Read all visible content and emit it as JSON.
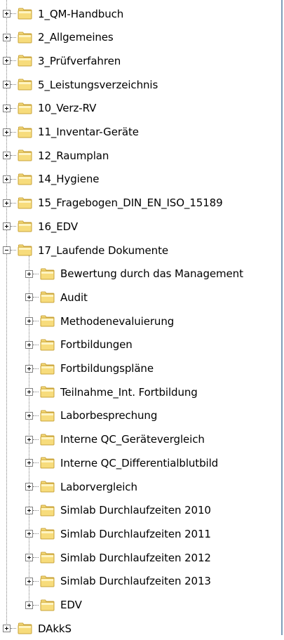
{
  "tree": {
    "top_items": [
      {
        "label": "1_QM-Handbuch",
        "state": "collapsed"
      },
      {
        "label": "2_Allgemeines",
        "state": "collapsed"
      },
      {
        "label": "3_Prüfverfahren",
        "state": "collapsed"
      },
      {
        "label": "5_Leistungsverzeichnis",
        "state": "collapsed"
      },
      {
        "label": "10_Verz-RV",
        "state": "collapsed"
      },
      {
        "label": "11_Inventar-Geräte",
        "state": "collapsed"
      },
      {
        "label": "12_Raumplan",
        "state": "collapsed"
      },
      {
        "label": "14_Hygiene",
        "state": "collapsed"
      },
      {
        "label": "15_Fragebogen_DIN_EN_ISO_15189",
        "state": "collapsed"
      },
      {
        "label": "16_EDV",
        "state": "collapsed"
      },
      {
        "label": "17_Laufende Dokumente",
        "state": "expanded"
      }
    ],
    "children": [
      {
        "label": "Bewertung durch das Management"
      },
      {
        "label": "Audit"
      },
      {
        "label": "Methodenevaluierung"
      },
      {
        "label": "Fortbildungen"
      },
      {
        "label": "Fortbildungspläne"
      },
      {
        "label": "Teilnahme_Int. Fortbildung"
      },
      {
        "label": "Laborbesprechung"
      },
      {
        "label": "Interne QC_Gerätevergleich"
      },
      {
        "label": "Interne QC_Differentialblutbild"
      },
      {
        "label": "Laborvergleich"
      },
      {
        "label": "Simlab Durchlaufzeiten 2010"
      },
      {
        "label": "Simlab Durchlaufzeiten 2011"
      },
      {
        "label": "Simlab Durchlaufzeiten 2012"
      },
      {
        "label": "Simlab Durchlaufzeiten 2013"
      },
      {
        "label": "EDV"
      }
    ],
    "last_item": {
      "label": "DAkkS",
      "state": "collapsed"
    }
  },
  "colors": {
    "folder_fill": "#f7dc7c",
    "folder_edge": "#c9a33a",
    "tree_line": "#808080",
    "frame_border": "#7f9db9"
  }
}
